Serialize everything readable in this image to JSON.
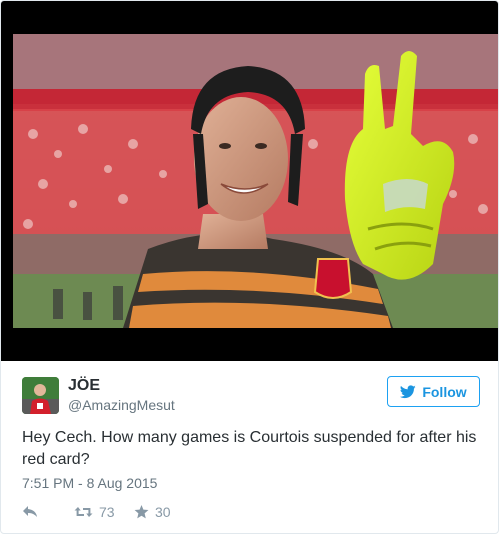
{
  "tweet": {
    "user_name": "JÖE",
    "user_handle": "@AmazingMesut",
    "follow_label": "Follow",
    "text": "Hey Cech. How many games is Courtois suspended for after his red card?",
    "timestamp": "7:51 PM - 8 Aug 2015",
    "retweet_count": "73",
    "like_count": "30"
  },
  "icons": {
    "follow": "twitter-bird-icon",
    "reply": "reply-arrow-icon",
    "retweet": "retweet-icon",
    "like": "star-icon"
  },
  "colors": {
    "twitter_blue": "#1b95e0",
    "text": "#292f33",
    "muted": "#66757f",
    "action_gray": "#8899a6",
    "glove_yellow": "#d4f01c"
  }
}
